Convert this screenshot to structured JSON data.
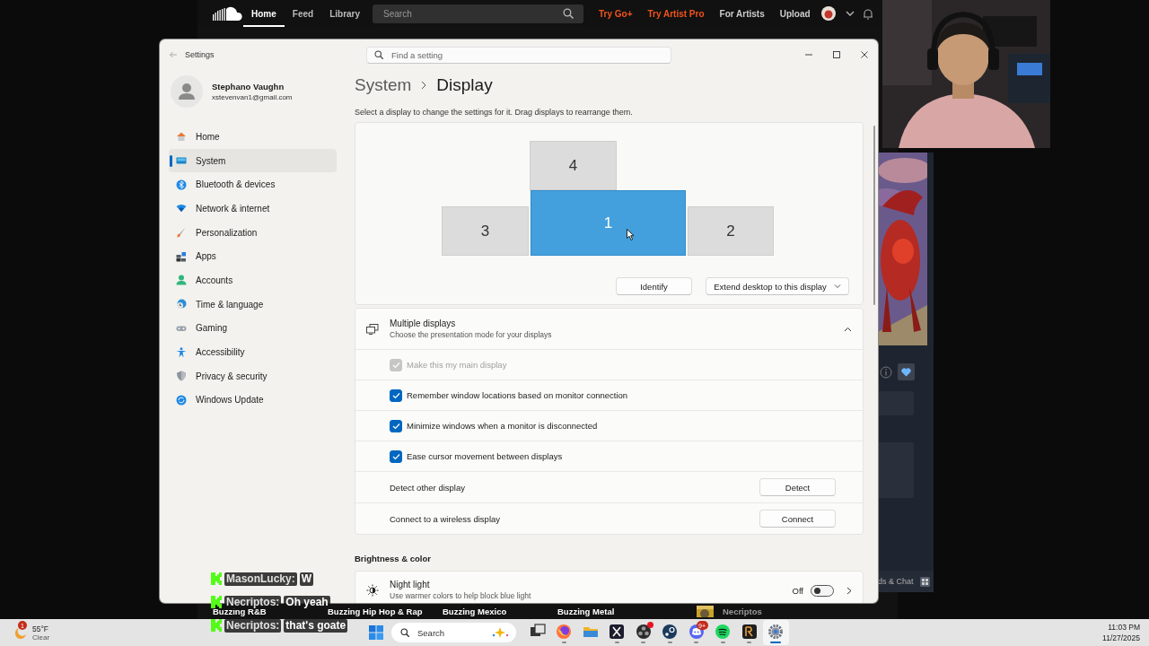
{
  "music_site": {
    "nav": [
      {
        "label": "Home",
        "selected": true
      },
      {
        "label": "Feed",
        "selected": false
      },
      {
        "label": "Library",
        "selected": false
      }
    ],
    "search": {
      "placeholder": "Search"
    },
    "links": [
      {
        "label": "Try Go+",
        "kind": "promo"
      },
      {
        "label": "Try Artist Pro",
        "kind": "promo"
      },
      {
        "label": "For Artists",
        "kind": "plain"
      },
      {
        "label": "Upload",
        "kind": "plain"
      }
    ],
    "genres": [
      "Buzzing R&B",
      "Buzzing Hip Hop & Rap",
      "Buzzing Mexico",
      "Buzzing Metal"
    ],
    "track_user": "Necriptos"
  },
  "side_app": {
    "footer": "ds & Chat"
  },
  "settings": {
    "title": "Settings",
    "search": {
      "placeholder": "Find a setting"
    },
    "account": {
      "name": "Stephano Vaughn",
      "email": "xstevenvan1@gmail.com"
    },
    "nav": [
      {
        "label": "Home",
        "selected": false
      },
      {
        "label": "System",
        "selected": true
      },
      {
        "label": "Bluetooth & devices",
        "selected": false
      },
      {
        "label": "Network & internet",
        "selected": false
      },
      {
        "label": "Personalization",
        "selected": false
      },
      {
        "label": "Apps",
        "selected": false
      },
      {
        "label": "Accounts",
        "selected": false
      },
      {
        "label": "Time & language",
        "selected": false
      },
      {
        "label": "Gaming",
        "selected": false
      },
      {
        "label": "Accessibility",
        "selected": false
      },
      {
        "label": "Privacy & security",
        "selected": false
      },
      {
        "label": "Windows Update",
        "selected": false
      }
    ],
    "breadcrumb": [
      "System",
      "Display"
    ],
    "hint": "Select a display to change the settings for it. Drag displays to rearrange them.",
    "displays": [
      {
        "label": "4",
        "selected": false
      },
      {
        "label": "3",
        "selected": false
      },
      {
        "label": "1",
        "selected": true
      },
      {
        "label": "2",
        "selected": false
      }
    ],
    "identify": "Identify",
    "extend": "Extend desktop to this display",
    "multiple_displays": {
      "title": "Multiple displays",
      "subtitle": "Choose the presentation mode for your displays",
      "expanded": true,
      "options": [
        {
          "label": "Make this my main display",
          "checked": true,
          "disabled": true
        },
        {
          "label": "Remember window locations based on monitor connection",
          "checked": true,
          "disabled": false
        },
        {
          "label": "Minimize windows when a monitor is disconnected",
          "checked": true,
          "disabled": false
        },
        {
          "label": "Ease cursor movement between displays",
          "checked": true,
          "disabled": false
        }
      ],
      "actions": [
        {
          "label": "Detect other display",
          "button": "Detect"
        },
        {
          "label": "Connect to a wireless display",
          "button": "Connect"
        }
      ]
    },
    "section": "Brightness & color",
    "night_light": {
      "title": "Night light",
      "subtitle": "Use warmer colors to help block blue light",
      "state": "Off",
      "on": false
    }
  },
  "chat": [
    {
      "user": "MasonLucky:",
      "message": "W"
    },
    {
      "user": "Necriptos:",
      "message": "Oh yeah"
    },
    {
      "user": "Necriptos:",
      "message": "that's goate"
    }
  ],
  "taskbar": {
    "weather": {
      "temperature": "55°F",
      "condition": "Clear",
      "badge": "1"
    },
    "search": {
      "placeholder": "Search"
    },
    "apps": [
      {
        "kind": "taskview",
        "running": false,
        "active": false,
        "alert": false
      },
      {
        "kind": "firefox",
        "running": true,
        "active": false,
        "alert": false
      },
      {
        "kind": "files",
        "running": false,
        "active": false,
        "alert": false
      },
      {
        "kind": "xapp",
        "running": true,
        "active": false,
        "alert": false
      },
      {
        "kind": "obs",
        "running": true,
        "active": false,
        "alert": true
      },
      {
        "kind": "steam",
        "running": true,
        "active": false,
        "alert": false
      },
      {
        "kind": "discord",
        "running": true,
        "active": false,
        "alert": false,
        "badge": "9+"
      },
      {
        "kind": "spotify",
        "running": true,
        "active": false,
        "alert": false
      },
      {
        "kind": "rl",
        "running": true,
        "active": false,
        "alert": false
      },
      {
        "kind": "settings",
        "running": true,
        "active": true,
        "alert": false
      }
    ],
    "time": "11:03 PM",
    "date": "11/27/2025"
  }
}
